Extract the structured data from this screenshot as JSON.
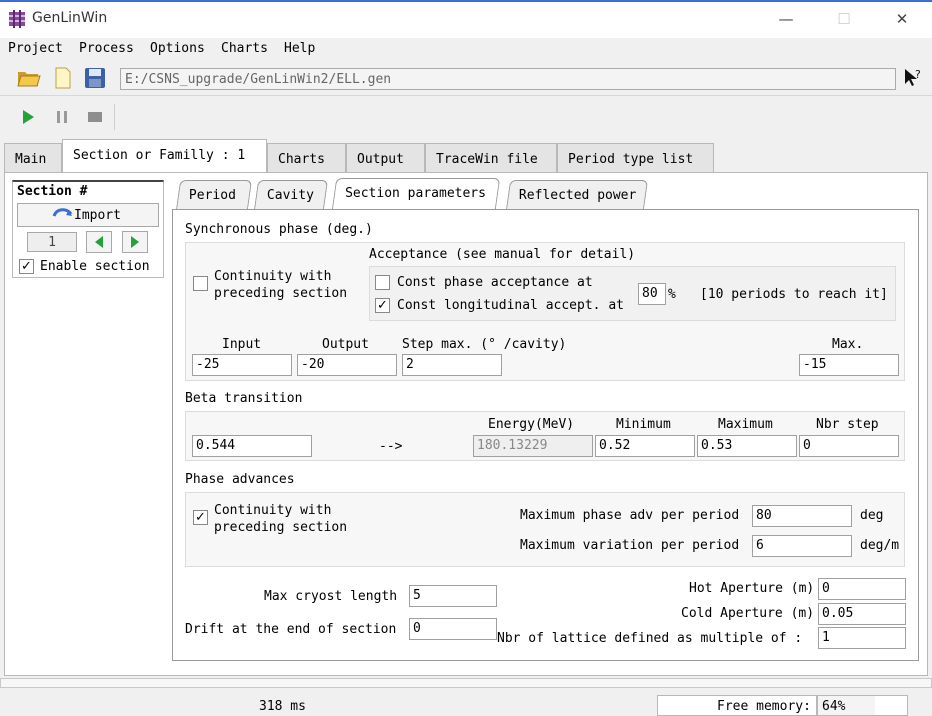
{
  "window": {
    "title": "GenLinWin",
    "minimize": "—",
    "maximize": "☐",
    "close": "✕"
  },
  "menu": [
    "Project",
    "Process",
    "Options",
    "Charts",
    "Help"
  ],
  "path": "E:/CSNS_upgrade/GenLinWin2/ELL.gen",
  "tabs": [
    "Main",
    "Section or Familly : 1",
    "Charts",
    "Output",
    "TraceWin file",
    "Period type list"
  ],
  "section_box": {
    "title": "Section #",
    "import": "Import",
    "number": "1",
    "enable": "Enable section",
    "enable_checked": true
  },
  "subtabs": [
    "Period",
    "Cavity",
    "Section parameters",
    "Reflected power"
  ],
  "sync": {
    "title": "Synchronous phase (deg.)",
    "continuity": "Continuity with\npreceding section",
    "continuity_checked": false,
    "acceptance_title": "Acceptance (see manual for detail)",
    "const_phase": "Const phase acceptance at",
    "const_phase_checked": false,
    "const_long": "Const longitudinal accept. at",
    "const_long_checked": true,
    "percent_value": "80",
    "percent_sign": "%",
    "periods_note": "[10 periods to reach it]",
    "input_label": "Input",
    "output_label": "Output",
    "step_label": "Step max. (° /cavity)",
    "max_label": "Max.",
    "input_value": "-25",
    "output_value": "-20",
    "step_value": "2",
    "max_value": "-15"
  },
  "beta": {
    "title": "Beta transition",
    "value": "0.544",
    "arrow": "-->",
    "energy_label": "Energy(MeV)",
    "min_label": "Minimum",
    "maxm_label": "Maximum",
    "nbr_label": "Nbr step",
    "energy_value": "180.13229",
    "min_value": "0.52",
    "max_value": "0.53",
    "nbr_value": "0"
  },
  "phase_adv": {
    "title": "Phase advances",
    "continuity": "Continuity with\npreceding section",
    "continuity_checked": true,
    "max_adv_label": "Maximum phase adv per period",
    "max_adv_value": "80",
    "max_adv_unit": "deg",
    "max_var_label": "Maximum variation per period",
    "max_var_value": "6",
    "max_var_unit": "deg/m"
  },
  "misc": {
    "cryost_label": "Max cryost length",
    "cryost_value": "5",
    "drift_label": "Drift at the end of section",
    "drift_value": "0",
    "hot_label": "Hot Aperture (m)",
    "hot_value": "0",
    "cold_label": "Cold Aperture (m)",
    "cold_value": "0.05",
    "lattice_label": "Nbr of lattice defined as multiple of :",
    "lattice_value": "1"
  },
  "status": {
    "time": "318 ms",
    "free_label": "Free memory:",
    "free_value": "64%",
    "free_fraction": 0.64
  },
  "colors": {
    "play": "#22a33a",
    "accent": "#3b6fd6"
  }
}
